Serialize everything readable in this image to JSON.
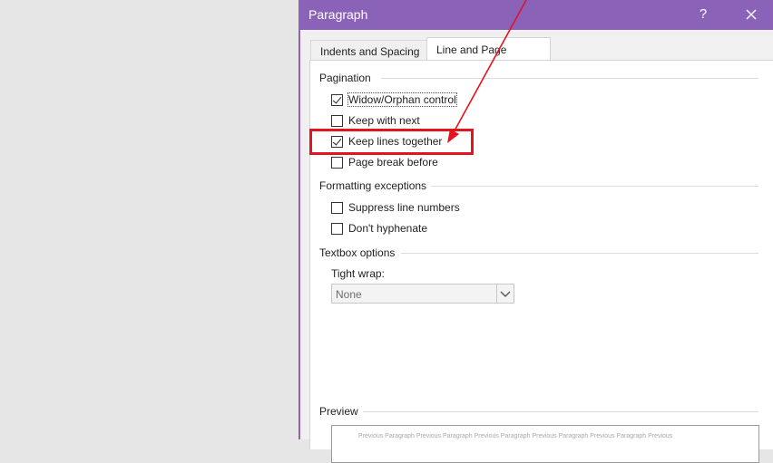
{
  "dialog": {
    "title": "Paragraph",
    "help_label": "?",
    "close_icon": "close-icon"
  },
  "tabs": [
    {
      "label": "Indents and Spacing",
      "active": false
    },
    {
      "label": "Line and Page Breaks",
      "active": true
    }
  ],
  "pagination": {
    "title": "Pagination",
    "items": [
      {
        "label": "Widow/Orphan control",
        "checked": true
      },
      {
        "label": "Keep with next",
        "checked": false
      },
      {
        "label": "Keep lines together",
        "checked": true
      },
      {
        "label": "Page break before",
        "checked": false
      }
    ]
  },
  "formatting_exceptions": {
    "title": "Formatting exceptions",
    "items": [
      {
        "label": "Suppress line numbers",
        "checked": false
      },
      {
        "label": "Don't hyphenate",
        "checked": false
      }
    ]
  },
  "textbox_options": {
    "title": "Textbox options",
    "tight_wrap_label": "Tight wrap:",
    "tight_wrap_value": "None"
  },
  "preview": {
    "title": "Preview",
    "text": "Previous Paragraph Previous Paragraph Previous Paragraph Previous Paragraph Previous Paragraph Previous"
  },
  "colors": {
    "titlebar": "#8a63b8",
    "annotation_red": "#e3141e"
  }
}
